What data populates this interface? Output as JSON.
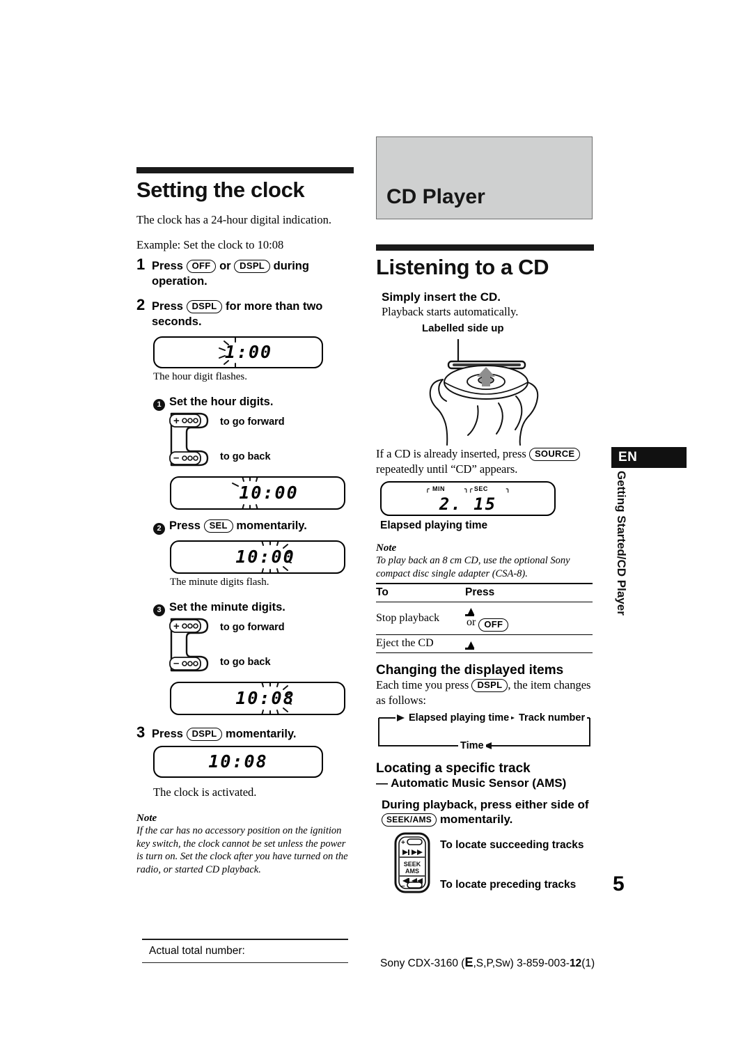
{
  "left": {
    "heading": "Setting the clock",
    "intro": "The clock has a 24-hour digital indication.",
    "example": "Example: Set the clock to 10:08",
    "step1": {
      "num": "1",
      "pre": "Press",
      "key1": "OFF",
      "mid": "or",
      "key2": "DSPL",
      "post": "during operation."
    },
    "step2": {
      "num": "2",
      "pre": "Press",
      "key1": "DSPL",
      "post": "for more than two seconds."
    },
    "lcd1": "1:00",
    "cap1": "The hour digit flashes.",
    "sub1": {
      "bullet": "1",
      "text": "Set the hour digits."
    },
    "rocker1": {
      "plus": "+",
      "minus": "–",
      "dots": "ooo",
      "forward": "to go forward",
      "back": "to go back"
    },
    "lcd2": "10:00",
    "sub2": {
      "bullet": "2",
      "pre": "Press",
      "key": "SEL",
      "post": "momentarily."
    },
    "lcd3": "10:00",
    "cap3": "The minute digits flash.",
    "sub3": {
      "bullet": "3",
      "text": "Set the minute digits."
    },
    "rocker2": {
      "plus": "+",
      "minus": "–",
      "dots": "ooo",
      "forward": "to go forward",
      "back": "to go back"
    },
    "lcd4": "10:08",
    "step3": {
      "num": "3",
      "pre": "Press",
      "key1": "DSPL",
      "post": "momentarily."
    },
    "lcd5": "10:08",
    "cap5": "The clock is activated.",
    "note_h": "Note",
    "note_b": "If the car has no accessory position on the ignition key switch, the clock cannot be set unless the power is turn on. Set the clock after you have turned on the radio, or started CD playback."
  },
  "right": {
    "chapter": "CD Player",
    "heading": "Listening to a CD",
    "insert_h": "Simply insert the CD.",
    "insert_b": "Playback starts automatically.",
    "label_up": "Labelled side up",
    "already_pre": "If a CD is already inserted, press",
    "already_key": "SOURCE",
    "already_post": "repeatedly until “CD” appears.",
    "lcd_min": "MIN",
    "lcd_sec": "SEC",
    "lcd_time": "2. 15",
    "elapsed_cap": "Elapsed playing time",
    "note_h": "Note",
    "note_b": "To play back an 8 cm CD, use the optional Sony compact disc single adapter (CSA-8).",
    "table": {
      "headers": [
        "To",
        "Press"
      ],
      "rows": [
        {
          "to": "Stop playback",
          "press_icon": "eject-icon",
          "press_mid": "or",
          "press_key": "OFF"
        },
        {
          "to": "Eject the CD",
          "press_icon": "eject-icon",
          "press_mid": "",
          "press_key": ""
        }
      ]
    },
    "display_h": "Changing the displayed items",
    "display_pre": "Each time you press",
    "display_key": "DSPL",
    "display_post": ", the item changes as follows:",
    "cycle": {
      "a": "Elapsed playing time",
      "b": "Track number",
      "c": "Time"
    },
    "locate_h": "Locating a specific track",
    "locate_sub": "— Automatic Music Sensor (AMS)",
    "locate_pre": "During playback, press either side of",
    "locate_key": "SEEK/AMS",
    "locate_post": "momentarily.",
    "seek": {
      "label1": "SEEK",
      "label2": "AMS",
      "plus": "+",
      "minus": "–"
    },
    "succeed": "To locate succeeding tracks",
    "precede": "To locate preceding tracks"
  },
  "tab": {
    "lang": "EN",
    "side": "Getting Started/CD Player"
  },
  "page_number": "5",
  "footer": {
    "left_label": "Actual total number:",
    "right_pre": "Sony CDX-3160 (",
    "right_e": "E",
    "right_mid": ",S,P,Sw)  3-859-003-",
    "right_b": "12",
    "right_post": "(1)"
  }
}
